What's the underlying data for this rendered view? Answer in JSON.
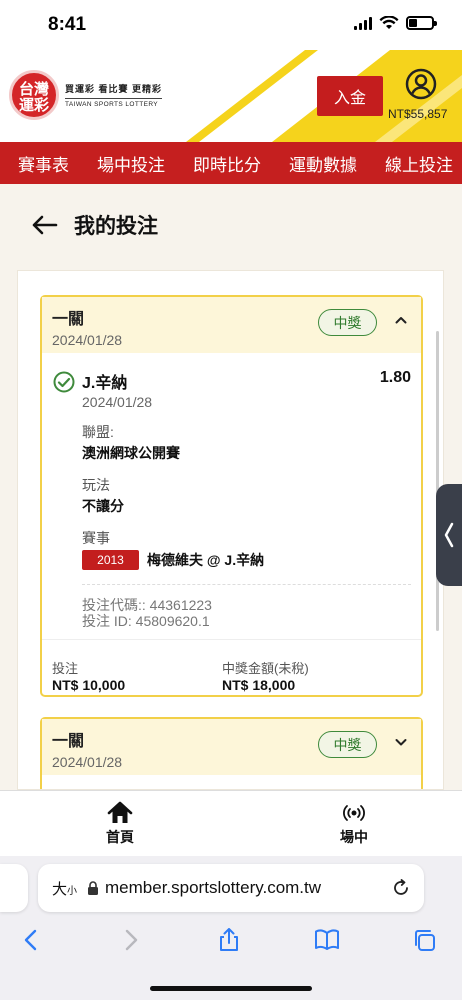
{
  "status_bar": {
    "time": "8:41"
  },
  "header": {
    "logo_mark": "台灣運彩",
    "logo_slogan": "買運彩 看比賽 更精彩",
    "logo_english": "TAIWAN SPORTS LOTTERY",
    "deposit_label": "入金",
    "balance": "NT$55,857",
    "accent_color": "#f5d31c",
    "brand_red": "#c51f1f"
  },
  "nav": {
    "items": [
      "賽事表",
      "場中投注",
      "即時比分",
      "運動數據",
      "線上投注"
    ]
  },
  "page": {
    "title": "我的投注"
  },
  "bets": [
    {
      "type": "一關",
      "date": "2024/01/28",
      "status": "中獎",
      "expanded": true,
      "selection": {
        "name": "J.辛納",
        "date": "2024/01/28",
        "odds": "1.80",
        "league_label": "聯盟:",
        "league": "澳洲網球公開賽",
        "play_label": "玩法",
        "play": "不讓分",
        "event_label": "賽事",
        "event_code": "2013",
        "event_name": "梅德維夫 @ J.辛納"
      },
      "bet_code": "投注代碼:: 44361223",
      "bet_id": "投注 ID: 45809620.1",
      "stake_label": "投注",
      "stake": "NT$ 10,000",
      "payout_label": "中獎金額(未稅)",
      "payout": "NT$ 18,000"
    },
    {
      "type": "一關",
      "date": "2024/01/28",
      "status": "中獎",
      "expanded": false
    }
  ],
  "bottom_nav": {
    "home": "首頁",
    "live": "場中"
  },
  "browser": {
    "text_size": "大",
    "text_size_small": "小",
    "url": "member.sportslottery.com.tw"
  }
}
